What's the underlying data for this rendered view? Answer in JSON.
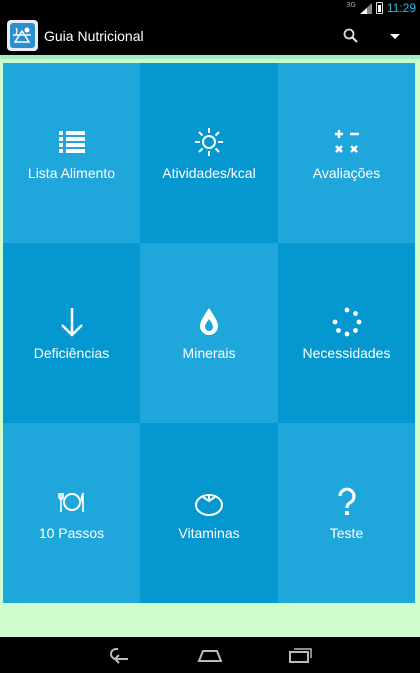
{
  "status_bar": {
    "network": "3G",
    "time": "11:29"
  },
  "action_bar": {
    "title": "Guia Nutricional",
    "actions": [
      {
        "name": "search",
        "icon": "search-icon"
      },
      {
        "name": "overflow",
        "icon": "overflow-dropdown-icon"
      }
    ]
  },
  "tiles": [
    {
      "label": "Lista Alimento",
      "icon": "list-icon",
      "tone": "light"
    },
    {
      "label": "Atividades/kcal",
      "icon": "sun-icon",
      "tone": "dark"
    },
    {
      "label": "Avaliações",
      "icon": "calculator-icon",
      "tone": "light"
    },
    {
      "label": "Deficiências",
      "icon": "arrow-down-icon",
      "tone": "dark"
    },
    {
      "label": "Minerais",
      "icon": "water-drop-icon",
      "tone": "light"
    },
    {
      "label": "Necessidades",
      "icon": "loading-dots-icon",
      "tone": "dark"
    },
    {
      "label": "10 Passos",
      "icon": "plate-cutlery-icon",
      "tone": "light"
    },
    {
      "label": "Vitaminas",
      "icon": "tomato-icon",
      "tone": "dark"
    },
    {
      "label": "Teste",
      "icon": "question-mark-icon",
      "tone": "light"
    }
  ],
  "colors": {
    "tile_light": "#1fa7dc",
    "tile_dark": "#0597cf",
    "background": "#cdfccd",
    "clock": "#33b5e5"
  },
  "nav_bar": {
    "buttons": [
      "back-icon",
      "home-icon",
      "recent-apps-icon"
    ]
  }
}
